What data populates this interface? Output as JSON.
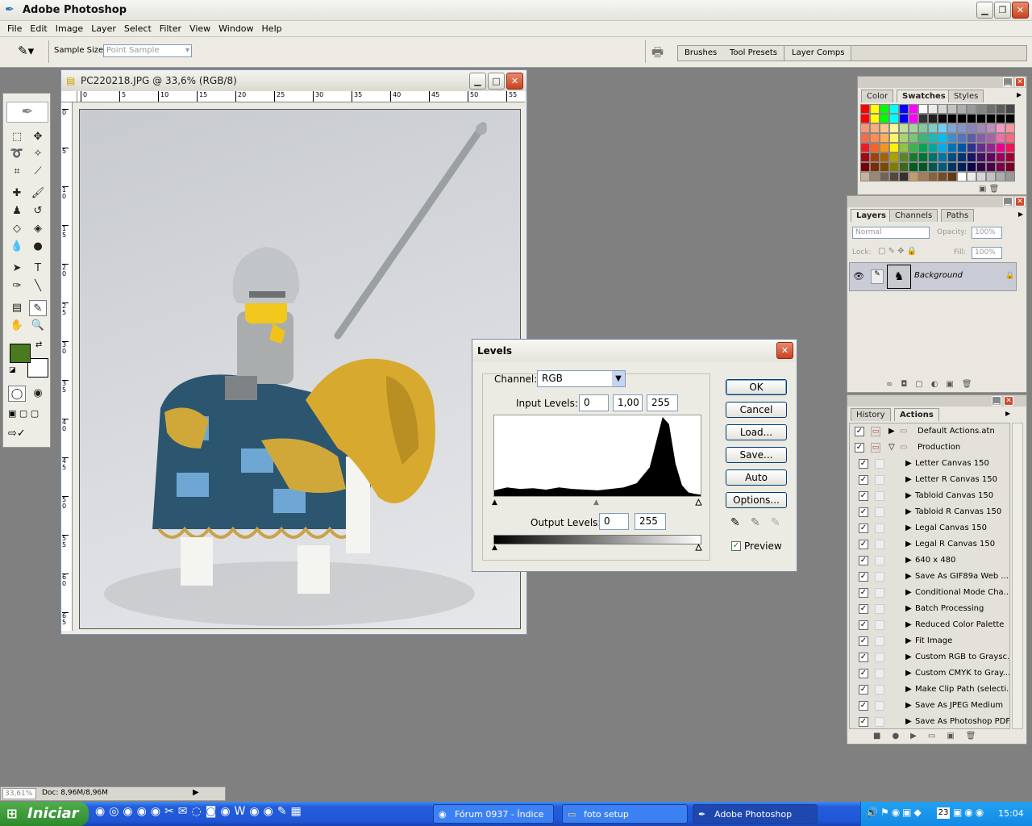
{
  "app": {
    "title": "Adobe Photoshop"
  },
  "menu": [
    "File",
    "Edit",
    "Image",
    "Layer",
    "Select",
    "Filter",
    "View",
    "Window",
    "Help"
  ],
  "options": {
    "sample_size_label": "Sample Size:",
    "sample_size_value": "Point Sample"
  },
  "palette_well": {
    "tabs": [
      "Brushes",
      "Tool Presets",
      "Layer Comps"
    ]
  },
  "document": {
    "title": "PC220218.JPG @ 33,6% (RGB/8)",
    "ruler_x": [
      "0",
      "5",
      "10",
      "15",
      "20",
      "25",
      "30",
      "35",
      "40",
      "45",
      "50",
      "55"
    ],
    "ruler_y": [
      "0",
      "5",
      "1 0",
      "1 5",
      "2 0",
      "2 5",
      "3 0",
      "3 5",
      "4 0",
      "4 5",
      "5 0",
      "5 5",
      "6 0",
      "6 5"
    ]
  },
  "levels": {
    "title": "Levels",
    "channel_label": "Channel:",
    "channel_value": "RGB",
    "input_label": "Input Levels:",
    "input_values": [
      "0",
      "1,00",
      "255"
    ],
    "output_label": "Output Levels:",
    "output_values": [
      "0",
      "255"
    ],
    "buttons": [
      "OK",
      "Cancel",
      "Load...",
      "Save...",
      "Auto",
      "Options..."
    ],
    "preview_label": "Preview",
    "preview_checked": true
  },
  "swatches_panel": {
    "tabs": [
      "Color",
      "Swatches",
      "Styles"
    ],
    "active": "Swatches",
    "colors": [
      "#ff0000",
      "#ffff00",
      "#00ff00",
      "#00ffff",
      "#0000ff",
      "#ff00ff",
      "#ffffff",
      "#ebebeb",
      "#d6d6d6",
      "#c2c2c2",
      "#adadad",
      "#999999",
      "#858585",
      "#707070",
      "#5c5c5c",
      "#474747",
      "#ff0000",
      "#ffff00",
      "#00ff00",
      "#00ffff",
      "#0000ff",
      "#ff00ff",
      "#333333",
      "#1f1f1f",
      "#0a0a0a",
      "#000000",
      "#000000",
      "#000000",
      "#000000",
      "#000000",
      "#000000",
      "#000000",
      "#f7977a",
      "#f9ad81",
      "#fdc68a",
      "#fff79a",
      "#c4df9b",
      "#a2d39c",
      "#82ca9d",
      "#7bcdc8",
      "#6ecff6",
      "#7ea7d8",
      "#8493ca",
      "#8882be",
      "#a187be",
      "#bc8dbf",
      "#f49ac2",
      "#f6989d",
      "#f26c4f",
      "#f68e55",
      "#fbaf5c",
      "#fff467",
      "#acd372",
      "#7cc576",
      "#3bb878",
      "#1abbb4",
      "#00bff3",
      "#438cca",
      "#5574b9",
      "#605ca8",
      "#855fa8",
      "#a763a8",
      "#f06eaa",
      "#f26d7d",
      "#ed1c24",
      "#f26522",
      "#f7941d",
      "#fff200",
      "#8dc73f",
      "#39b54a",
      "#00a651",
      "#00a99d",
      "#00aeef",
      "#0072bc",
      "#0054a6",
      "#2e3192",
      "#662d91",
      "#92278f",
      "#ec008c",
      "#ed145b",
      "#9e0b0f",
      "#a0410d",
      "#a3620a",
      "#aba000",
      "#598527",
      "#1a7b30",
      "#007236",
      "#00746b",
      "#0076a3",
      "#004b80",
      "#003471",
      "#1b1464",
      "#440e62",
      "#630460",
      "#9e005d",
      "#9e0039",
      "#790000",
      "#7b2e00",
      "#7d4900",
      "#827b00",
      "#406618",
      "#005e20",
      "#005826",
      "#005952",
      "#005b7f",
      "#003663",
      "#002157",
      "#0d004c",
      "#32004b",
      "#4b0049",
      "#7b0046",
      "#7a0026",
      "#c7b299",
      "#998675",
      "#736357",
      "#534741",
      "#37302d",
      "#c69c6d",
      "#a67c52",
      "#8c6239",
      "#754c24",
      "#603913",
      "#ffffff",
      "#ebebeb",
      "#d6d6d6",
      "#c2c2c2",
      "#adadad",
      "#999999"
    ]
  },
  "layers_panel": {
    "tabs": [
      "Layers",
      "Channels",
      "Paths"
    ],
    "active": "Layers",
    "blend_mode": "Normal",
    "opacity_label": "Opacity:",
    "opacity_value": "100%",
    "lock_label": "Lock:",
    "fill_label": "Fill:",
    "fill_value": "100%",
    "layers": [
      {
        "name": "Background",
        "visible": true,
        "locked": true
      }
    ]
  },
  "actions_panel": {
    "tabs": [
      "History",
      "Actions"
    ],
    "active": "Actions",
    "sets": [
      {
        "name": "Default Actions.atn",
        "expanded": false
      },
      {
        "name": "Production",
        "expanded": true
      }
    ],
    "actions": [
      "Letter Canvas 150",
      "Letter R Canvas 150",
      "Tabloid Canvas 150",
      "Tabloid R Canvas 150",
      "Legal Canvas 150",
      "Legal R Canvas 150",
      "640 x 480",
      "Save As GIF89a Web ...",
      "Conditional Mode Cha...",
      "Batch Processing",
      "Reduced Color Palette",
      "Fit Image",
      "Custom RGB to Graysc...",
      "Custom CMYK to Gray...",
      "Make Clip Path (selecti...",
      "Save As JPEG Medium",
      "Save As Photoshop PDF"
    ]
  },
  "status": {
    "zoom": "33,61%",
    "doc": "Doc: 8,96M/8,96M"
  },
  "colors": {
    "foreground": "#4a7a1f",
    "background": "#ffffff"
  },
  "taskbar": {
    "start": "Iniciar",
    "tasks": [
      "Fórum 0937 - Índice -...",
      "foto setup",
      "Adobe Photoshop"
    ],
    "active_task": "Adobe Photoshop",
    "clock": "15:04",
    "tray_badge": "23"
  },
  "chart_data": {
    "type": "area",
    "title": "",
    "x": [
      0,
      16,
      32,
      48,
      64,
      80,
      96,
      112,
      128,
      144,
      160,
      176,
      192,
      208,
      216,
      224,
      232,
      240,
      248,
      255
    ],
    "values": [
      8,
      12,
      10,
      11,
      9,
      12,
      10,
      9,
      8,
      10,
      12,
      18,
      40,
      110,
      100,
      45,
      15,
      5,
      3,
      2
    ],
    "xlim": [
      0,
      255
    ]
  }
}
